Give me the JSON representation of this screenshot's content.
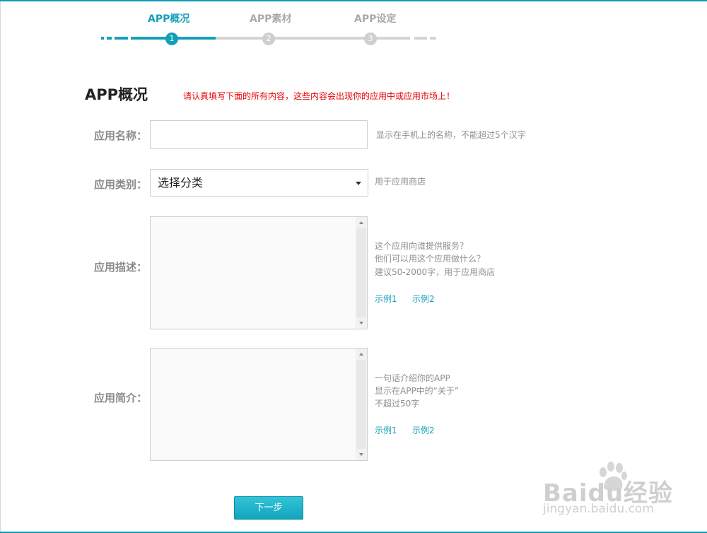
{
  "colors": {
    "accent": "#14a0b8",
    "warning": "#e60000",
    "inactive": "#aaaaaa"
  },
  "stepper": {
    "steps": [
      {
        "label": "APP概况",
        "number": "1",
        "state": "active"
      },
      {
        "label": "APP素材",
        "number": "2",
        "state": "inactive"
      },
      {
        "label": "APP设定",
        "number": "3",
        "state": "inactive"
      }
    ]
  },
  "page": {
    "title": "APP概况",
    "warning": "请认真填写下面的所有内容，这些内容会出现你的应用中或应用市场上！"
  },
  "form": {
    "name": {
      "label": "应用名称：",
      "value": "",
      "hint": "显示在手机上的名称，不能超过5个汉字"
    },
    "category": {
      "label": "应用类别：",
      "selected": "选择分类",
      "hint": "用于应用商店",
      "icon": "dropdown-caret-icon"
    },
    "description": {
      "label": "应用描述：",
      "value": "",
      "hint_lines": [
        "这个应用向谁提供服务？",
        "他们可以用这个应用做什么？",
        "建议50-2000字，用于应用商店"
      ],
      "examples": [
        "示例1",
        "示例2"
      ]
    },
    "intro": {
      "label": "应用简介：",
      "value": "",
      "hint_lines": [
        "一句话介绍你的APP",
        "显示在APP中的“关于”",
        "不超过50字"
      ],
      "examples": [
        "示例1",
        "示例2"
      ]
    }
  },
  "actions": {
    "next_label": "下一步"
  },
  "watermark": {
    "brand": "Baidu经验",
    "url": "jingyan.baidu.com",
    "icon": "baidu-paw-icon"
  }
}
